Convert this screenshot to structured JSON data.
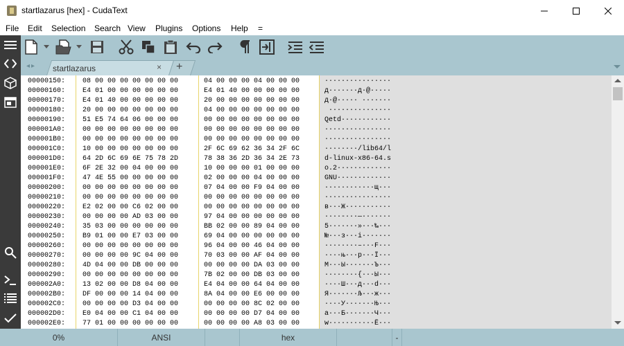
{
  "window": {
    "title": "startlazarus [hex] - CudaText",
    "min_icon": "minimize-icon",
    "max_icon": "maximize-icon",
    "close_icon": "close-icon"
  },
  "menu": [
    "File",
    "Edit",
    "Selection",
    "Search",
    "View",
    "Plugins",
    "Options",
    "Help",
    "="
  ],
  "toolbar_icons": [
    "new-file-icon",
    "open-file-icon",
    "save-icon",
    "cut-icon",
    "copy-icon",
    "paste-icon",
    "undo-icon",
    "redo-icon",
    "show-unprinted-icon",
    "wrap-icon",
    "indent-icon",
    "unindent-icon"
  ],
  "sidebar_icons": [
    "menu-icon",
    "code-tree-icon",
    "project-icon",
    "tabs-icon",
    "search-icon",
    "console-icon",
    "output-icon",
    "validate-icon"
  ],
  "tabs": {
    "nav": "◂▸",
    "active_label": "startlazarus",
    "close": "×",
    "add": "+"
  },
  "hex_rows": [
    {
      "offset": "00000150:",
      "h1": "08 00 00 00 00 00 00 00",
      "h2": "04 00 00 00 04 00 00 00",
      "ascii": "················"
    },
    {
      "offset": "00000160:",
      "h1": "E4 01 00 00 00 00 00 00",
      "h2": "E4 01 40 00 00 00 00 00",
      "ascii": "д·······д·@·····"
    },
    {
      "offset": "00000170:",
      "h1": "E4 01 40 00 00 00 00 00",
      "h2": "20 00 00 00 00 00 00 00",
      "ascii": "д·@····· ·······"
    },
    {
      "offset": "00000180:",
      "h1": "20 00 00 00 00 00 00 00",
      "h2": "04 00 00 00 00 00 00 00",
      "ascii": " ···············"
    },
    {
      "offset": "00000190:",
      "h1": "51 E5 74 64 06 00 00 00",
      "h2": "00 00 00 00 00 00 00 00",
      "ascii": "Qetd············"
    },
    {
      "offset": "000001A0:",
      "h1": "00 00 00 00 00 00 00 00",
      "h2": "00 00 00 00 00 00 00 00",
      "ascii": "················"
    },
    {
      "offset": "000001B0:",
      "h1": "00 00 00 00 00 00 00 00",
      "h2": "00 00 00 00 00 00 00 00",
      "ascii": "················"
    },
    {
      "offset": "000001C0:",
      "h1": "10 00 00 00 00 00 00 00",
      "h2": "2F 6C 69 62 36 34 2F 6C",
      "ascii": "········/lib64/l"
    },
    {
      "offset": "000001D0:",
      "h1": "64 2D 6C 69 6E 75 78 2D",
      "h2": "78 38 36 2D 36 34 2E 73",
      "ascii": "d-linux-x86-64.s"
    },
    {
      "offset": "000001E0:",
      "h1": "6F 2E 32 00 04 00 00 00",
      "h2": "10 00 00 00 01 00 00 00",
      "ascii": "o.2·············"
    },
    {
      "offset": "000001F0:",
      "h1": "47 4E 55 00 00 00 00 00",
      "h2": "02 00 00 00 04 00 00 00",
      "ascii": "GNU·············"
    },
    {
      "offset": "00000200:",
      "h1": "00 00 00 00 00 00 00 00",
      "h2": "07 04 00 00 F9 04 00 00",
      "ascii": "············щ···"
    },
    {
      "offset": "00000210:",
      "h1": "00 00 00 00 00 00 00 00",
      "h2": "00 00 00 00 00 00 00 00",
      "ascii": "················"
    },
    {
      "offset": "00000220:",
      "h1": "E2 02 00 00 C6 02 00 00",
      "h2": "00 00 00 00 00 00 00 00",
      "ascii": "в···Ж···········"
    },
    {
      "offset": "00000230:",
      "h1": "00 00 00 00 AD 03 00 00",
      "h2": "97 04 00 00 00 00 00 00",
      "ascii": "····-···—·······"
    },
    {
      "offset": "00000240:",
      "h1": "35 03 00 00 00 00 00 00",
      "h2": "BB 02 00 00 89 04 00 00",
      "ascii": "5·······»···‰···"
    },
    {
      "offset": "00000250:",
      "h1": "B9 01 00 00 E7 03 00 00",
      "h2": "69 04 00 00 00 00 00 00",
      "ascii": "№···з···i·······"
    },
    {
      "offset": "00000260:",
      "h1": "00 00 00 00 00 00 00 00",
      "h2": "96 04 00 00 46 04 00 00",
      "ascii": "········–···F···"
    },
    {
      "offset": "00000270:",
      "h1": "00 00 00 00 9C 04 00 00",
      "h2": "70 03 00 00 AF 04 00 00",
      "ascii": "····њ···p···Ї···"
    },
    {
      "offset": "00000280:",
      "h1": "4D 04 00 00 DB 00 00 00",
      "h2": "00 00 00 00 DA 03 00 00",
      "ascii": "M···Ы·······Ъ···"
    },
    {
      "offset": "00000290:",
      "h1": "00 00 00 00 00 00 00 00",
      "h2": "7B 02 00 00 DB 03 00 00",
      "ascii": "········{···Ы···"
    },
    {
      "offset": "000002A0:",
      "h1": "13 02 00 00 D8 04 00 00",
      "h2": "E4 04 00 00 64 04 00 00",
      "ascii": "····Ш···д···d···"
    },
    {
      "offset": "000002B0:",
      "h1": "DF 00 00 00 14 04 00 00",
      "h2": "8A 04 00 00 E6 00 00 00",
      "ascii": "Я·······Љ···ж···"
    },
    {
      "offset": "000002C0:",
      "h1": "00 00 00 00 D3 04 00 00",
      "h2": "00 00 00 00 8C 02 00 00",
      "ascii": "····У·······Њ···"
    },
    {
      "offset": "000002D0:",
      "h1": "E0 04 00 00 C1 04 00 00",
      "h2": "00 00 00 00 D7 04 00 00",
      "ascii": "а···Б·······Ч···"
    },
    {
      "offset": "000002E0:",
      "h1": "77 01 00 00 00 00 00 00",
      "h2": "00 00 00 00 A8 03 00 00",
      "ascii": "w···········Ё···"
    }
  ],
  "status": {
    "percent": "0%",
    "encoding": "ANSI",
    "mode": "hex",
    "dash": "-"
  }
}
